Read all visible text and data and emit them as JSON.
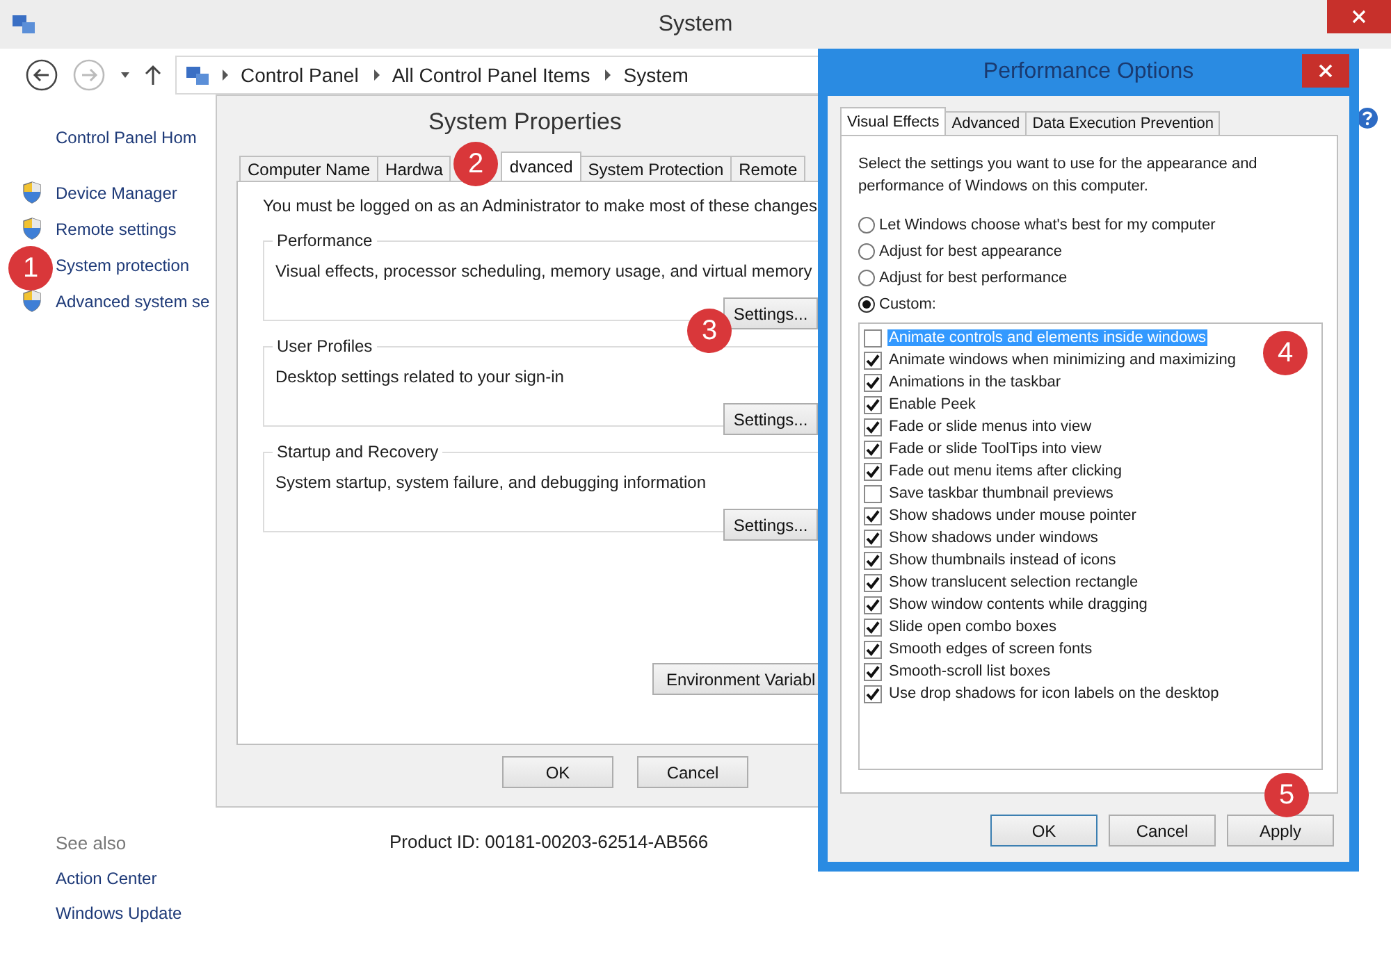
{
  "system_window": {
    "title": "System",
    "breadcrumb": [
      "Control Panel",
      "All Control Panel Items",
      "System"
    ],
    "sidebar": {
      "home": "Control Panel Hom",
      "links": [
        "Device Manager",
        "Remote settings",
        "System protection",
        "Advanced system se"
      ]
    },
    "see_also": {
      "heading": "See also",
      "links": [
        "Action Center",
        "Windows Update"
      ]
    },
    "product_id": "Product ID: 00181-00203-62514-AB566"
  },
  "system_properties": {
    "title": "System Properties",
    "tabs": [
      {
        "label": "Computer Name",
        "selected": false
      },
      {
        "label": "Hardwa",
        "selected": false
      },
      {
        "label": "dvanced",
        "selected": true
      },
      {
        "label": "System Protection",
        "selected": false
      },
      {
        "label": "Remote",
        "selected": false
      }
    ],
    "admin_note": "You must be logged on as an Administrator to make most of these changes",
    "groups": [
      {
        "title": "Performance",
        "description": "Visual effects, processor scheduling, memory usage, and virtual memory",
        "button": "Settings..."
      },
      {
        "title": "User Profiles",
        "description": "Desktop settings related to your sign-in",
        "button": "Settings..."
      },
      {
        "title": "Startup and Recovery",
        "description": "System startup, system failure, and debugging information",
        "button": "Settings..."
      }
    ],
    "env_button": "Environment Variabl",
    "buttons": [
      "OK",
      "Cancel"
    ]
  },
  "performance_options": {
    "title": "Performance Options",
    "tabs": [
      {
        "label": "Visual Effects",
        "selected": true
      },
      {
        "label": "Advanced",
        "selected": false
      },
      {
        "label": "Data Execution Prevention",
        "selected": false
      }
    ],
    "intro": "Select the settings you want to use for the appearance and performance of Windows on this computer.",
    "options": [
      {
        "label": "Let Windows choose what's best for my computer",
        "selected": false
      },
      {
        "label": "Adjust for best appearance",
        "selected": false
      },
      {
        "label": "Adjust for best performance",
        "selected": false
      },
      {
        "label": "Custom:",
        "selected": true
      }
    ],
    "effects": [
      {
        "label": "Animate controls and elements inside windows",
        "checked": false,
        "selected": true
      },
      {
        "label": "Animate windows when minimizing and maximizing",
        "checked": true,
        "selected": false
      },
      {
        "label": "Animations in the taskbar",
        "checked": true,
        "selected": false
      },
      {
        "label": "Enable Peek",
        "checked": true,
        "selected": false
      },
      {
        "label": "Fade or slide menus into view",
        "checked": true,
        "selected": false
      },
      {
        "label": "Fade or slide ToolTips into view",
        "checked": true,
        "selected": false
      },
      {
        "label": "Fade out menu items after clicking",
        "checked": true,
        "selected": false
      },
      {
        "label": "Save taskbar thumbnail previews",
        "checked": false,
        "selected": false
      },
      {
        "label": "Show shadows under mouse pointer",
        "checked": true,
        "selected": false
      },
      {
        "label": "Show shadows under windows",
        "checked": true,
        "selected": false
      },
      {
        "label": "Show thumbnails instead of icons",
        "checked": true,
        "selected": false
      },
      {
        "label": "Show translucent selection rectangle",
        "checked": true,
        "selected": false
      },
      {
        "label": "Show window contents while dragging",
        "checked": true,
        "selected": false
      },
      {
        "label": "Slide open combo boxes",
        "checked": true,
        "selected": false
      },
      {
        "label": "Smooth edges of screen fonts",
        "checked": true,
        "selected": false
      },
      {
        "label": "Smooth-scroll list boxes",
        "checked": true,
        "selected": false
      },
      {
        "label": "Use drop shadows for icon labels on the desktop",
        "checked": true,
        "selected": false
      }
    ],
    "buttons": [
      "OK",
      "Cancel",
      "Apply"
    ]
  },
  "callouts": [
    "1",
    "2",
    "3",
    "4",
    "5"
  ]
}
